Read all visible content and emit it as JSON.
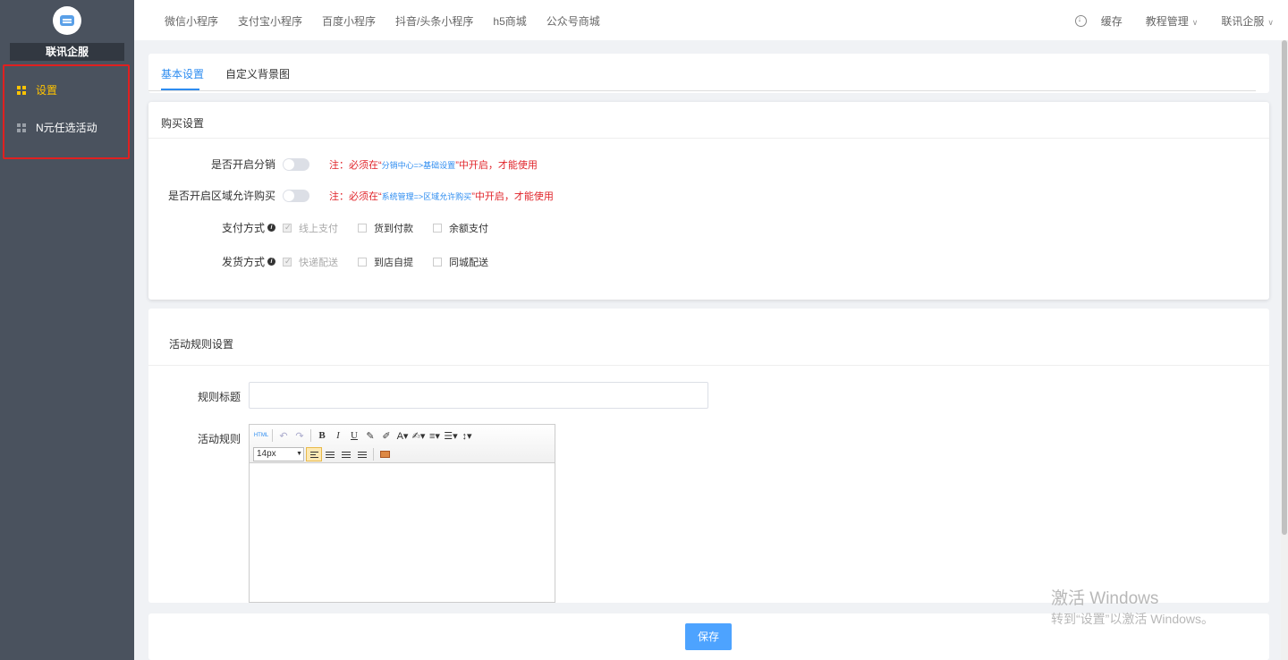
{
  "sidebar": {
    "brand": "联讯企服",
    "items": [
      {
        "label": "设置",
        "icon": "grid-icon",
        "active": true
      },
      {
        "label": "N元任选活动",
        "icon": "grid-icon",
        "active": false
      }
    ]
  },
  "topbar": {
    "nav": [
      "微信小程序",
      "支付宝小程序",
      "百度小程序",
      "抖音/头条小程序",
      "h5商城",
      "公众号商城"
    ],
    "cache": "缓存",
    "tutorial": "教程管理",
    "user": "联讯企服"
  },
  "tabs": [
    "基本设置",
    "自定义背景图"
  ],
  "purchase": {
    "title": "购买设置",
    "distribution_label": "是否开启分销",
    "distribution_note_pre": "注：必须在“",
    "distribution_note_link": "分销中心=>基础设置",
    "distribution_note_post": "”中开启，才能使用",
    "region_label": "是否开启区域允许购买",
    "region_note_pre": "注：必须在“",
    "region_note_link": "系统管理=>区域允许购买",
    "region_note_post": "”中开启，才能使用",
    "payment_label": "支付方式",
    "payment_options": [
      "线上支付",
      "货到付款",
      "余额支付"
    ],
    "delivery_label": "发货方式",
    "delivery_options": [
      "快递配送",
      "到店自提",
      "同城配送"
    ]
  },
  "rules": {
    "title": "活动规则设置",
    "rule_title_label": "规则标题",
    "rule_title_value": "",
    "rule_content_label": "活动规则",
    "font_size": "14px"
  },
  "save_label": "保存",
  "watermark": {
    "line1": "激活 Windows",
    "line2": "转到“设置”以激活 Windows。"
  },
  "colors": {
    "sidebar_bg": "#4a525e",
    "active_menu": "#ffc300",
    "primary": "#2d8cf0",
    "note_red": "#e0242a",
    "save_button": "#4da3ff"
  }
}
